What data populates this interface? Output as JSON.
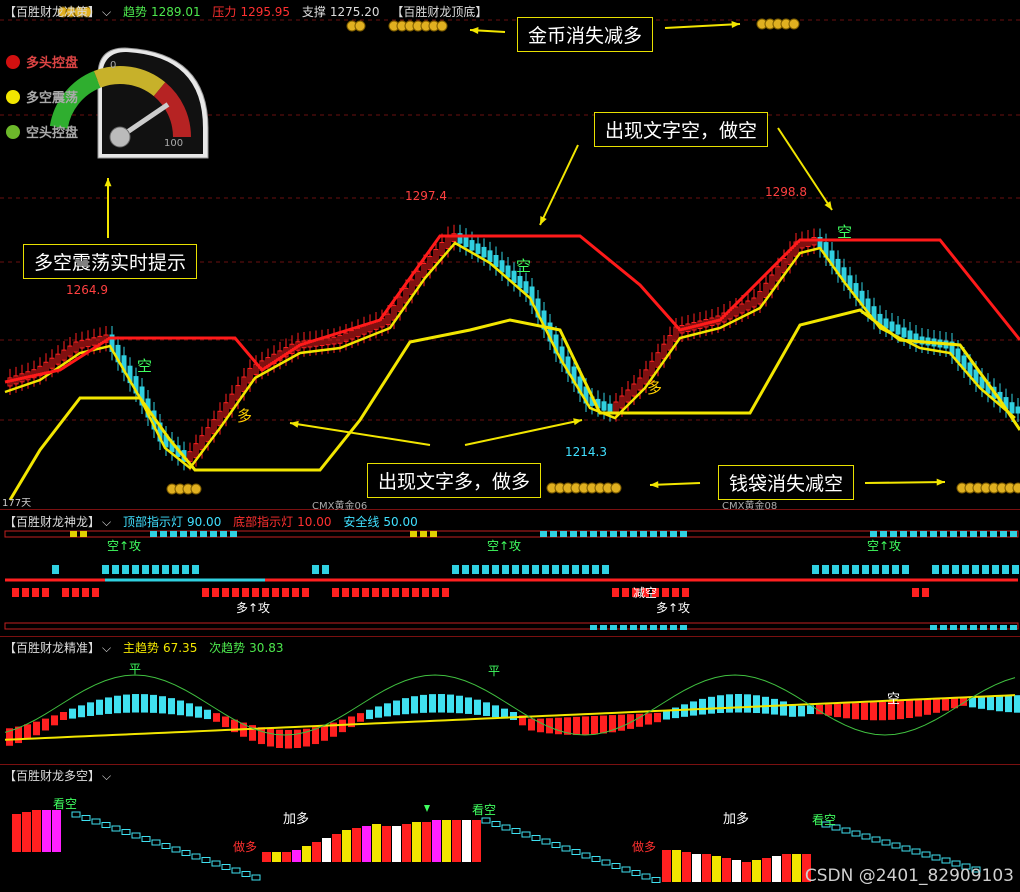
{
  "panel1": {
    "title": "【百胜财龙决策】",
    "trend_label": "趋势",
    "trend_value": "1289.01",
    "pressure_label": "压力",
    "pressure_value": "1295.95",
    "support_label": "支撑",
    "support_value": "1275.20",
    "topbottom_label": "【百胜财龙顶底】",
    "price_labels": [
      "1297.4",
      "1298.8",
      "1264.9",
      "1214.3"
    ],
    "day_label": "177天",
    "contract_labels": [
      "CMX黄金06",
      "CMX黄金08"
    ],
    "signal_labels": [
      "空",
      "空",
      "空",
      "多",
      "多"
    ]
  },
  "legend": [
    {
      "label": "多头控盘",
      "color": "#d11010"
    },
    {
      "label": "多空震荡",
      "color": "#f2e600"
    },
    {
      "label": "空头控盘",
      "color": "#6cb82a"
    }
  ],
  "gauge": {
    "min_label": "0",
    "max_label": "100",
    "value": 80
  },
  "annotations": {
    "coins_decrease": "金币消失减多",
    "text_short": "出现文字空，做空",
    "oscillation": "多空震荡实时提示",
    "text_long": "出现文字多，做多",
    "bags_decrease": "钱袋消失减空"
  },
  "panel2": {
    "title": "【百胜财龙神龙】",
    "top_label": "顶部指示灯",
    "top_value": "90.00",
    "bottom_label": "底部指示灯",
    "bottom_value": "10.00",
    "safety_label": "安全线",
    "safety_value": "50.00",
    "short_attack": "空↑攻",
    "long_attack": "多↑攻",
    "reduce_short": "减空"
  },
  "panel3": {
    "title": "【百胜财龙精准】",
    "main_label": "主趋势",
    "main_value": "67.35",
    "sub_label": "次趋势",
    "sub_value": "30.83",
    "flat": "平",
    "short": "空"
  },
  "panel4": {
    "title": "【百胜财龙多空】",
    "watch_short": "看空",
    "add_long": "加多",
    "do_long": "做多"
  },
  "watermark": "CSDN @2401_82909103",
  "chart_data": {
    "type": "line",
    "title": "【百胜财龙决策】",
    "x": [
      0,
      10,
      20,
      30,
      40,
      50,
      60,
      70,
      80,
      90,
      100,
      110,
      120,
      130,
      140,
      150,
      160,
      170,
      176
    ],
    "series": [
      {
        "name": "趋势",
        "values": [
          1262,
          1266,
          1258,
          1240,
          1222,
          1226,
          1248,
          1262,
          1270,
          1285,
          1296,
          1294,
          1280,
          1258,
          1232,
          1214,
          1226,
          1252,
          1262
        ]
      }
    ],
    "annotations": [
      "1297.4",
      "1298.8",
      "1264.9",
      "1214.3"
    ]
  }
}
